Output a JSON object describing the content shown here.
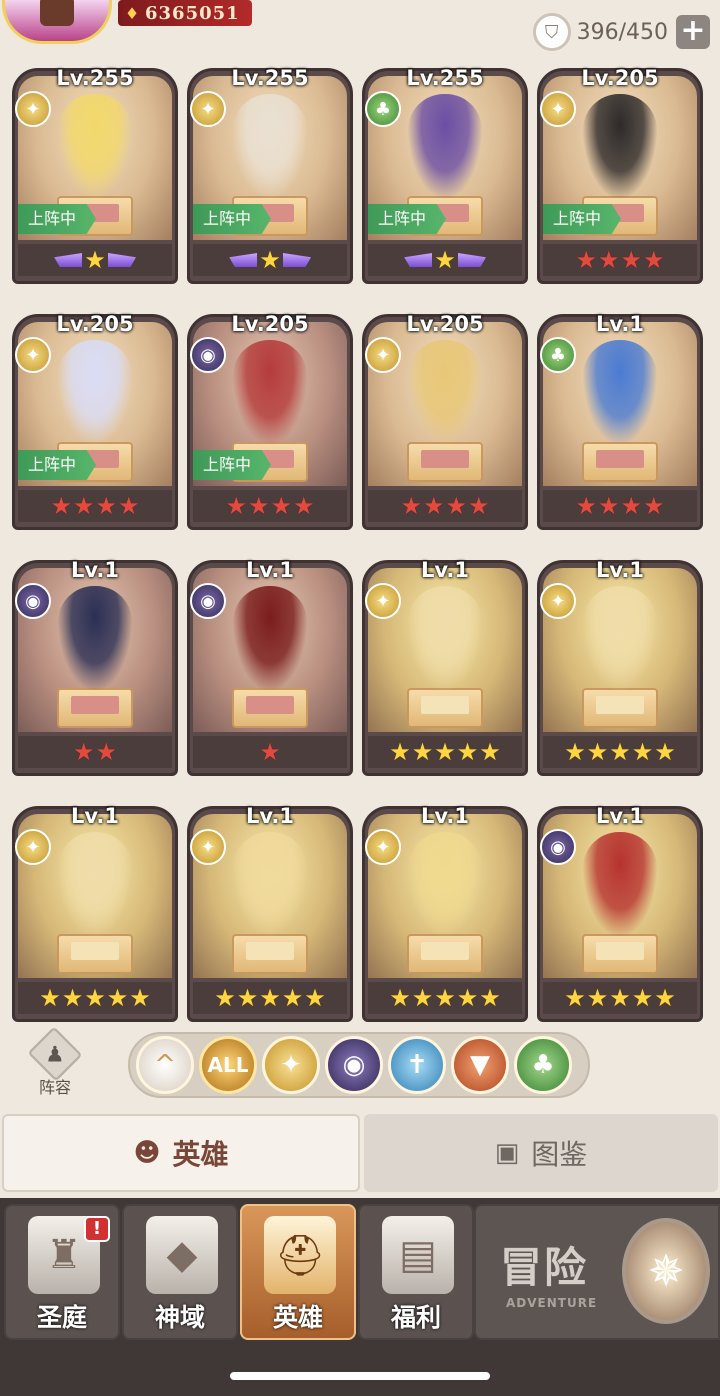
{
  "header": {
    "power_value": "6365051",
    "capacity": "396/450",
    "add_label": "+"
  },
  "heroes": [
    {
      "level": "Lv.255",
      "faction": "light",
      "on_team": true,
      "stars": 1,
      "star_style": "wing-yellow"
    },
    {
      "level": "Lv.255",
      "faction": "light",
      "on_team": true,
      "stars": 1,
      "star_style": "wing-yellow"
    },
    {
      "level": "Lv.255",
      "faction": "nature",
      "on_team": true,
      "stars": 1,
      "star_style": "wing-yellow"
    },
    {
      "level": "Lv.205",
      "faction": "light",
      "on_team": true,
      "stars": 4,
      "star_style": "red"
    },
    {
      "level": "Lv.205",
      "faction": "light",
      "on_team": true,
      "stars": 4,
      "star_style": "red"
    },
    {
      "level": "Lv.205",
      "faction": "dark",
      "on_team": true,
      "stars": 4,
      "star_style": "red"
    },
    {
      "level": "Lv.205",
      "faction": "light",
      "on_team": false,
      "stars": 4,
      "star_style": "red"
    },
    {
      "level": "Lv.1",
      "faction": "nature",
      "on_team": false,
      "stars": 4,
      "star_style": "red"
    },
    {
      "level": "Lv.1",
      "faction": "dark",
      "on_team": false,
      "stars": 2,
      "star_style": "red"
    },
    {
      "level": "Lv.1",
      "faction": "dark",
      "on_team": false,
      "stars": 1,
      "star_style": "red"
    },
    {
      "level": "Lv.1",
      "faction": "light",
      "on_team": false,
      "stars": 5,
      "star_style": "yellow"
    },
    {
      "level": "Lv.1",
      "faction": "light",
      "on_team": false,
      "stars": 5,
      "star_style": "yellow"
    },
    {
      "level": "Lv.1",
      "faction": "light",
      "on_team": false,
      "stars": 5,
      "star_style": "yellow"
    },
    {
      "level": "Lv.1",
      "faction": "light",
      "on_team": false,
      "stars": 5,
      "star_style": "yellow"
    },
    {
      "level": "Lv.1",
      "faction": "light",
      "on_team": false,
      "stars": 5,
      "star_style": "yellow"
    },
    {
      "level": "Lv.1",
      "faction": "dark",
      "on_team": false,
      "stars": 5,
      "star_style": "yellow"
    }
  ],
  "on_team_label": "上阵中",
  "lineup_label": "阵容",
  "filters": [
    {
      "key": "up",
      "label": "^"
    },
    {
      "key": "all",
      "label": "ALL"
    },
    {
      "key": "light",
      "label": "✦"
    },
    {
      "key": "dark",
      "label": "◉"
    },
    {
      "key": "holy",
      "label": "✝"
    },
    {
      "key": "beast",
      "label": "▼"
    },
    {
      "key": "nature",
      "label": "♣"
    }
  ],
  "tabs": {
    "heroes": "英雄",
    "codex": "图鉴"
  },
  "nav": {
    "court": "圣庭",
    "domain": "神域",
    "heroes": "英雄",
    "welfare": "福利",
    "adventure": "冒险",
    "adventure_en": "ADVENTURE",
    "court_badge": "!"
  },
  "colors": {
    "on_team": "#3e9a57",
    "star_red": "#e34a3e",
    "star_yellow": "#ffd640",
    "nav_active": "#d9975a"
  }
}
